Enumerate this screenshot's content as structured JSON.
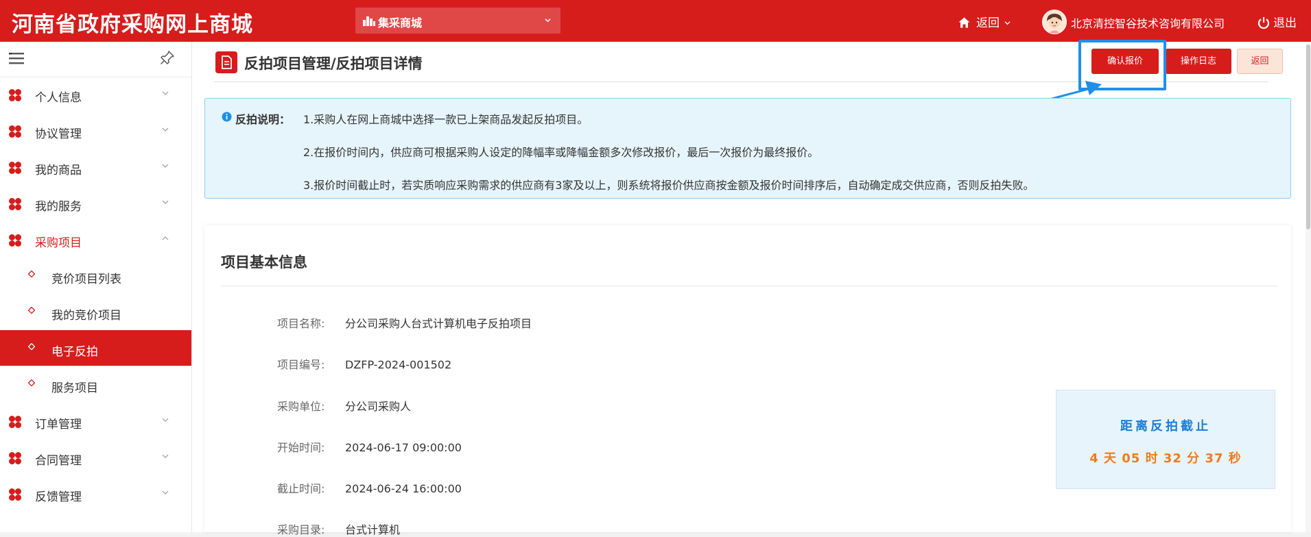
{
  "header": {
    "logo_text": "河南省政府采购网上商城",
    "mall_select": "集采商城",
    "back_label": "返回",
    "company": "北京清控智谷技术咨询有限公司",
    "logout_label": "退出"
  },
  "sidebar": {
    "items": [
      {
        "label": "个人信息"
      },
      {
        "label": "协议管理"
      },
      {
        "label": "我的商品"
      },
      {
        "label": "我的服务"
      },
      {
        "label": "采购项目",
        "open": true
      },
      {
        "label": "订单管理"
      },
      {
        "label": "合同管理"
      },
      {
        "label": "反馈管理"
      }
    ],
    "sub_items": [
      {
        "label": "竞价项目列表"
      },
      {
        "label": "我的竞价项目"
      },
      {
        "label": "电子反拍",
        "active": true
      },
      {
        "label": "服务项目"
      }
    ]
  },
  "page": {
    "title": "反拍项目管理/反拍项目详情",
    "buttons": {
      "confirm": "确认报价",
      "log": "操作日志",
      "back": "返回"
    }
  },
  "notice": {
    "label": "反拍说明：",
    "lines": [
      "1.采购人在网上商城中选择一款已上架商品发起反拍项目。",
      "2.在报价时间内，供应商可根据采购人设定的降幅率或降幅金额多次修改报价，最后一次报价为最终报价。",
      "3.报价时间截止时，若实质响应采购需求的供应商有3家及以上，则系统将报价供应商按金额及报价时间排序后，自动确定成交供应商，否则反拍失败。"
    ]
  },
  "project": {
    "section_title": "项目基本信息",
    "fields": [
      {
        "label": "项目名称:",
        "value": "分公司采购人台式计算机电子反拍项目"
      },
      {
        "label": "项目编号:",
        "value": "DZFP-2024-001502"
      },
      {
        "label": "采购单位:",
        "value": "分公司采购人"
      },
      {
        "label": "开始时间:",
        "value": "2024-06-17 09:00:00"
      },
      {
        "label": "截止时间:",
        "value": "2024-06-24 16:00:00"
      },
      {
        "label": "采购目录:",
        "value": "台式计算机"
      }
    ]
  },
  "countdown": {
    "title": "距离反拍截止",
    "time": "4 天 05 时 32 分 37 秒"
  },
  "colors": {
    "brand_red": "#d71c1c",
    "highlight_blue": "#1e8fea",
    "countdown_blue": "#1a7dd6",
    "countdown_orange": "#f07a1c"
  },
  "icons": [
    "bar-chart-icon",
    "chevron-down-icon",
    "home-icon",
    "power-icon",
    "menu-icon",
    "pin-icon",
    "clover-icon",
    "diamond-icon",
    "document-icon",
    "info-icon",
    "chevron-up-icon"
  ]
}
